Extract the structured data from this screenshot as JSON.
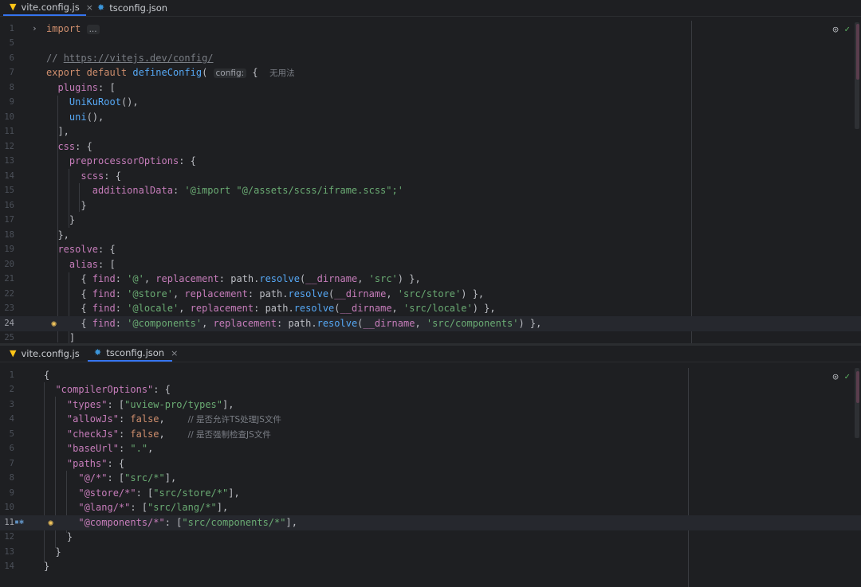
{
  "top": {
    "tabs": [
      {
        "label": "vite.config.js",
        "active": true,
        "icon": "vite-icon"
      },
      {
        "label": "tsconfig.json",
        "active": false,
        "icon": "json-icon"
      }
    ],
    "fold_placeholder": "...",
    "param_hint": "config:",
    "usage_hint": "无用法"
  },
  "bottom": {
    "tabs": [
      {
        "label": "vite.config.js",
        "active": false,
        "icon": "vite-icon"
      },
      {
        "label": "tsconfig.json",
        "active": true,
        "icon": "json-icon"
      }
    ],
    "comments": [
      "// 是否允许TS处理JS文件",
      "// 是否强制检查JS文件"
    ]
  },
  "close_glyph": "×",
  "colors": {
    "background": "#1e1f22",
    "keyword": "#cf8e6d",
    "function": "#56a8f5",
    "property": "#c77dbb",
    "string": "#6aab73",
    "comment": "#7a7e85",
    "accent": "#3574f0"
  }
}
